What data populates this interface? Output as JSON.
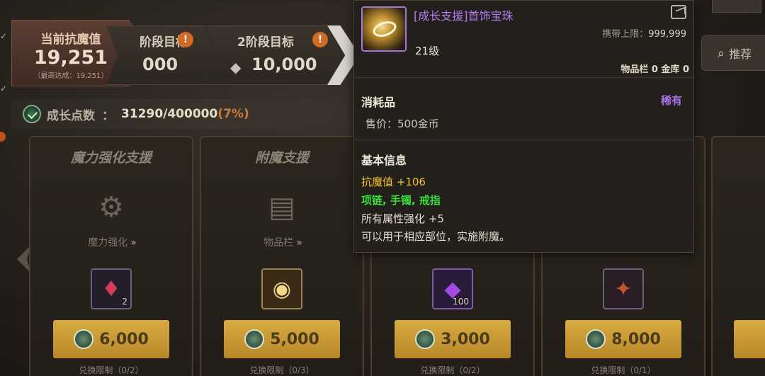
{
  "stage_current": {
    "label": "当前抗魔值",
    "value": "19,251",
    "sub": "（最高达成：19,251）"
  },
  "stage1": {
    "label": "阶段目标",
    "value": "000",
    "warn": "!"
  },
  "stage2": {
    "label": "2阶段目标",
    "value": "10,000",
    "warn": "!"
  },
  "growth": {
    "label": "成长点数",
    "colon": "：",
    "value": "31290/400000",
    "percent": "(7%)"
  },
  "cards": [
    {
      "title": "魔力强化支援",
      "feature": "魔力强化",
      "qty": "2",
      "price": "6,000",
      "limit": "兑换限制（0/2）"
    },
    {
      "title": "附魔支援",
      "feature": "物品栏",
      "qty": "",
      "price": "5,000",
      "limit": "兑换限制（0/3）"
    },
    {
      "title": "",
      "feature": "",
      "qty": "100",
      "price": "3,000",
      "limit": "兑换限制（0/2）"
    },
    {
      "title": "",
      "feature": "",
      "qty": "",
      "price": "8,000",
      "limit": "兑换限制（0/1）"
    },
    {
      "title": "",
      "feature": "",
      "qty": "",
      "price": "",
      "limit": ""
    }
  ],
  "right_search": {
    "label": "推荐"
  },
  "tooltip": {
    "name": "[成长支援]首饰宝珠",
    "carry_label": "携带上限：",
    "carry_value": "999,999",
    "level": "21级",
    "storage": "物品栏 0 金库 0",
    "type": "消耗品",
    "rarity": "稀有",
    "price": "售价：500金币",
    "basic_info": "基本信息",
    "stat1": "抗魔值 +106",
    "stat2": "项链, 手镯, 戒指",
    "stat3": "所有属性强化 +5",
    "stat4": "可以用于相应部位，实施附魔。"
  },
  "colors": {
    "rarity": "#a873ea",
    "stat_yellow": "#f0c22c",
    "stat_green": "#39dd3b",
    "price_button": "#d3a53c"
  }
}
